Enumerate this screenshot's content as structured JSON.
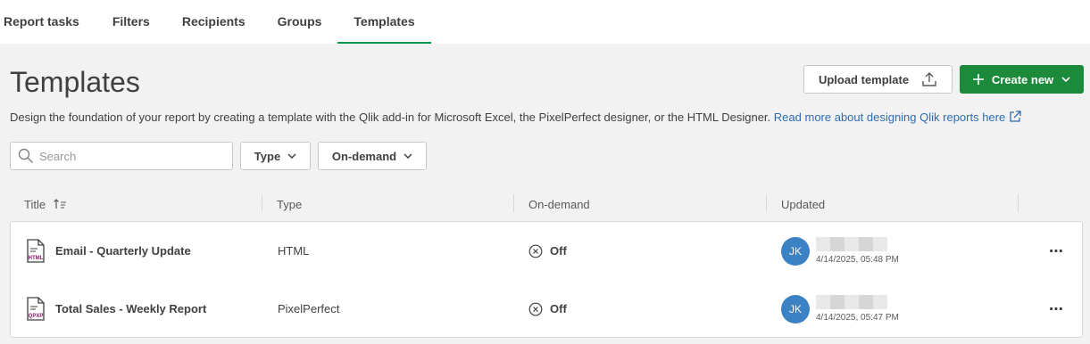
{
  "tabs": [
    {
      "label": "Report tasks"
    },
    {
      "label": "Filters"
    },
    {
      "label": "Recipients"
    },
    {
      "label": "Groups"
    },
    {
      "label": "Templates",
      "active": true
    }
  ],
  "page": {
    "title": "Templates",
    "description": "Design the foundation of your report by creating a template with the Qlik add-in for Microsoft Excel, the PixelPerfect designer, or the HTML Designer.",
    "link_text": "Read more about designing Qlik reports here"
  },
  "toolbar": {
    "upload_label": "Upload template",
    "create_label": "Create new"
  },
  "search": {
    "placeholder": "Search",
    "value": ""
  },
  "filters": {
    "type_label": "Type",
    "ondemand_label": "On-demand"
  },
  "table": {
    "headers": {
      "title": "Title",
      "type": "Type",
      "ondemand": "On-demand",
      "updated": "Updated"
    },
    "rows": [
      {
        "icon": "html-file-icon",
        "icon_text": "HTML",
        "title": "Email - Quarterly Update",
        "type": "HTML",
        "ondemand": "Off",
        "avatar": "JK",
        "updated": "4/14/2025, 05:48 PM"
      },
      {
        "icon": "qpxp-file-icon",
        "icon_text": "QPXP",
        "title": "Total Sales - Weekly Report",
        "type": "PixelPerfect",
        "ondemand": "Off",
        "avatar": "JK",
        "updated": "4/14/2025, 05:47 PM"
      }
    ]
  },
  "colors": {
    "accent": "#009845",
    "primary_button": "#1b8a3a",
    "link": "#2f6cb0",
    "avatar": "#3a82c4",
    "file_icon": "#8a1c6e"
  }
}
